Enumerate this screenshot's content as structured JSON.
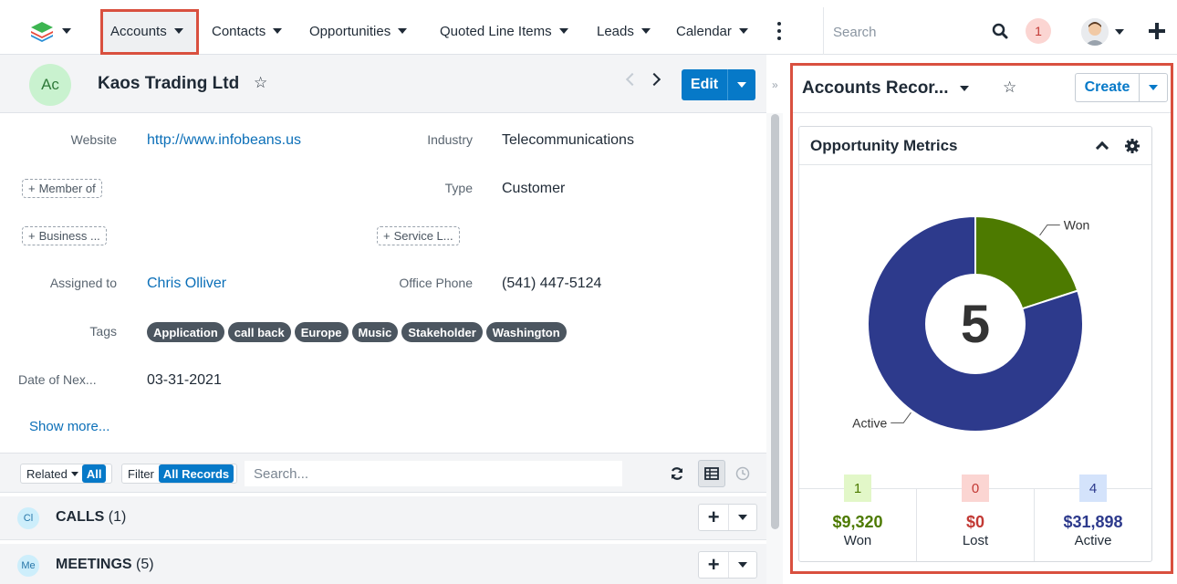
{
  "nav": {
    "tabs": [
      {
        "label": "Accounts"
      },
      {
        "label": "Contacts"
      },
      {
        "label": "Opportunities"
      },
      {
        "label": "Quoted Line Items"
      },
      {
        "label": "Leads"
      },
      {
        "label": "Calendar"
      }
    ],
    "search_placeholder": "Search",
    "notification_count": "1"
  },
  "record": {
    "avatar_initials": "Ac",
    "name": "Kaos Trading Ltd",
    "fields": {
      "website_label": "Website",
      "website_value": "http://www.infobeans.us",
      "industry_label": "Industry",
      "industry_value": "Telecommunications",
      "member_of_btn": "Member of",
      "type_label": "Type",
      "type_value": "Customer",
      "business_btn": "Business ...",
      "service_btn": "Service L...",
      "assigned_label": "Assigned to",
      "assigned_value": "Chris Olliver",
      "phone_label": "Office Phone",
      "phone_value": "(541) 447-5124",
      "tags_label": "Tags",
      "date_label": "Date of Nex...",
      "date_value": "03-31-2021"
    },
    "tags": [
      "Application",
      "call back",
      "Europe",
      "Music",
      "Stakeholder",
      "Washington"
    ],
    "show_more": "Show more...",
    "edit_label": "Edit"
  },
  "subpanels": {
    "related_label": "Related",
    "related_badge": "All",
    "filter_label": "Filter",
    "filter_badge": "All Records",
    "search_placeholder": "Search...",
    "rows": [
      {
        "icon": "Cl",
        "title": "CALLS",
        "count": "(1)"
      },
      {
        "icon": "Me",
        "title": "MEETINGS",
        "count": "(5)"
      }
    ]
  },
  "dashlet": {
    "title": "Accounts Recor...",
    "create_label": "Create",
    "metrics_title": "Opportunity Metrics",
    "center_total": "5",
    "counts": [
      {
        "count": "1",
        "amount": "$9,320",
        "label": "Won",
        "badge_bg": "#e2f7c8",
        "badge_fg": "#4d7a00",
        "amount_color": "#4d7a00"
      },
      {
        "count": "0",
        "amount": "$0",
        "label": "Lost",
        "badge_bg": "#fbd5d2",
        "badge_fg": "#c23934",
        "amount_color": "#c23934"
      },
      {
        "count": "4",
        "amount": "$31,898",
        "label": "Active",
        "badge_bg": "#d4e3fb",
        "badge_fg": "#2d3a8c",
        "amount_color": "#2d3a8c"
      }
    ]
  },
  "chart_data": {
    "type": "pie",
    "categories": [
      "Won",
      "Active"
    ],
    "values": [
      1,
      4
    ],
    "colors": [
      "#4d7a00",
      "#2d3a8c"
    ],
    "center_label": "5"
  }
}
